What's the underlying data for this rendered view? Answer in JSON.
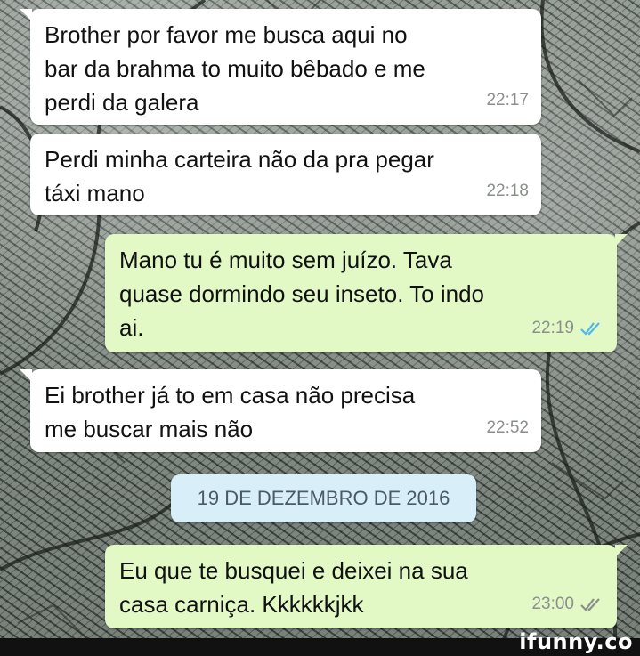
{
  "messages": [
    {
      "direction": "incoming",
      "text": "Brother por favor me busca aqui no\nbar da brahma to muito bêbado e me\nperdi da galera",
      "time": "22:17"
    },
    {
      "direction": "incoming",
      "text": "Perdi minha carteira não da pra pegar\ntáxi mano",
      "time": "22:18"
    },
    {
      "direction": "outgoing",
      "text": "Mano tu é muito sem juízo. Tava\nquase dormindo seu inseto. To indo\nai.",
      "time": "22:19",
      "status": "read-ticks"
    },
    {
      "direction": "incoming",
      "text": "Ei brother já to em casa não precisa\nme buscar mais não",
      "time": "22:52"
    },
    {
      "direction": "outgoing",
      "text": "Eu que te busquei e deixei na sua\ncasa carniça. Kkkkkkjkk",
      "time": "23:00",
      "status": "delivered-ticks"
    }
  ],
  "date_separator": "19 DE DEZEMBRO DE 2016",
  "watermark": "ifunny.co",
  "colors": {
    "incoming": "#ffffff",
    "outgoing": "#e2f9c6",
    "read_tick": "#4fb6ec",
    "delivered_tick": "#8a8f8a",
    "date_chip": "#d8eef8"
  }
}
